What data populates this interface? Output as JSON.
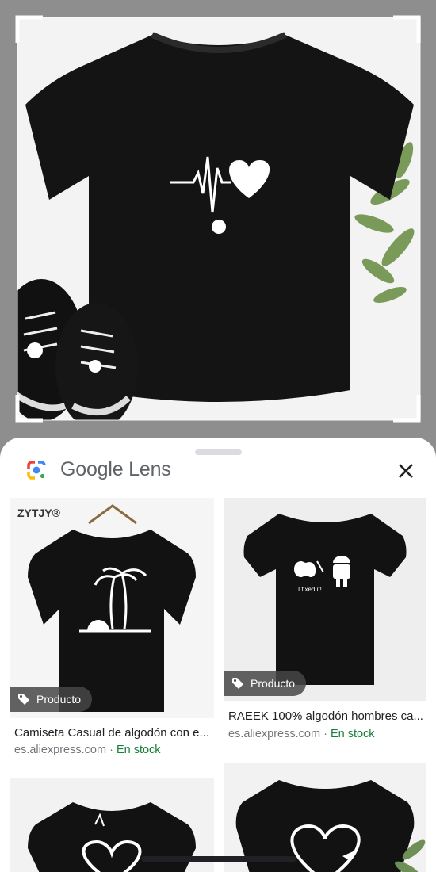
{
  "header": {
    "brand_google": "Google",
    "brand_lens": "Lens",
    "close_icon": "close-icon",
    "logo_icon": "google-lens-logo-icon"
  },
  "query": {
    "print_icon": "heartbeat-heart-icon"
  },
  "results": [
    {
      "logo": "ZYTJY®",
      "tag": "Producto",
      "title": "Camiseta Casual de algodón con e...",
      "source": "es.aliexpress.com",
      "separator": " · ",
      "stock": "En stock"
    },
    {
      "shirt_text": "I fixed it!",
      "tag": "Producto",
      "title": "RAEEK 100% algodón hombres ca...",
      "source": "es.aliexpress.com",
      "separator": " · ",
      "stock": "En stock"
    },
    {
      "tag": "",
      "title": "",
      "source": ""
    },
    {
      "tag": "",
      "title": "",
      "source": ""
    }
  ],
  "colors": {
    "stock_green": "#188038",
    "sheet_bg": "#ffffff",
    "shirt": "#111111"
  }
}
